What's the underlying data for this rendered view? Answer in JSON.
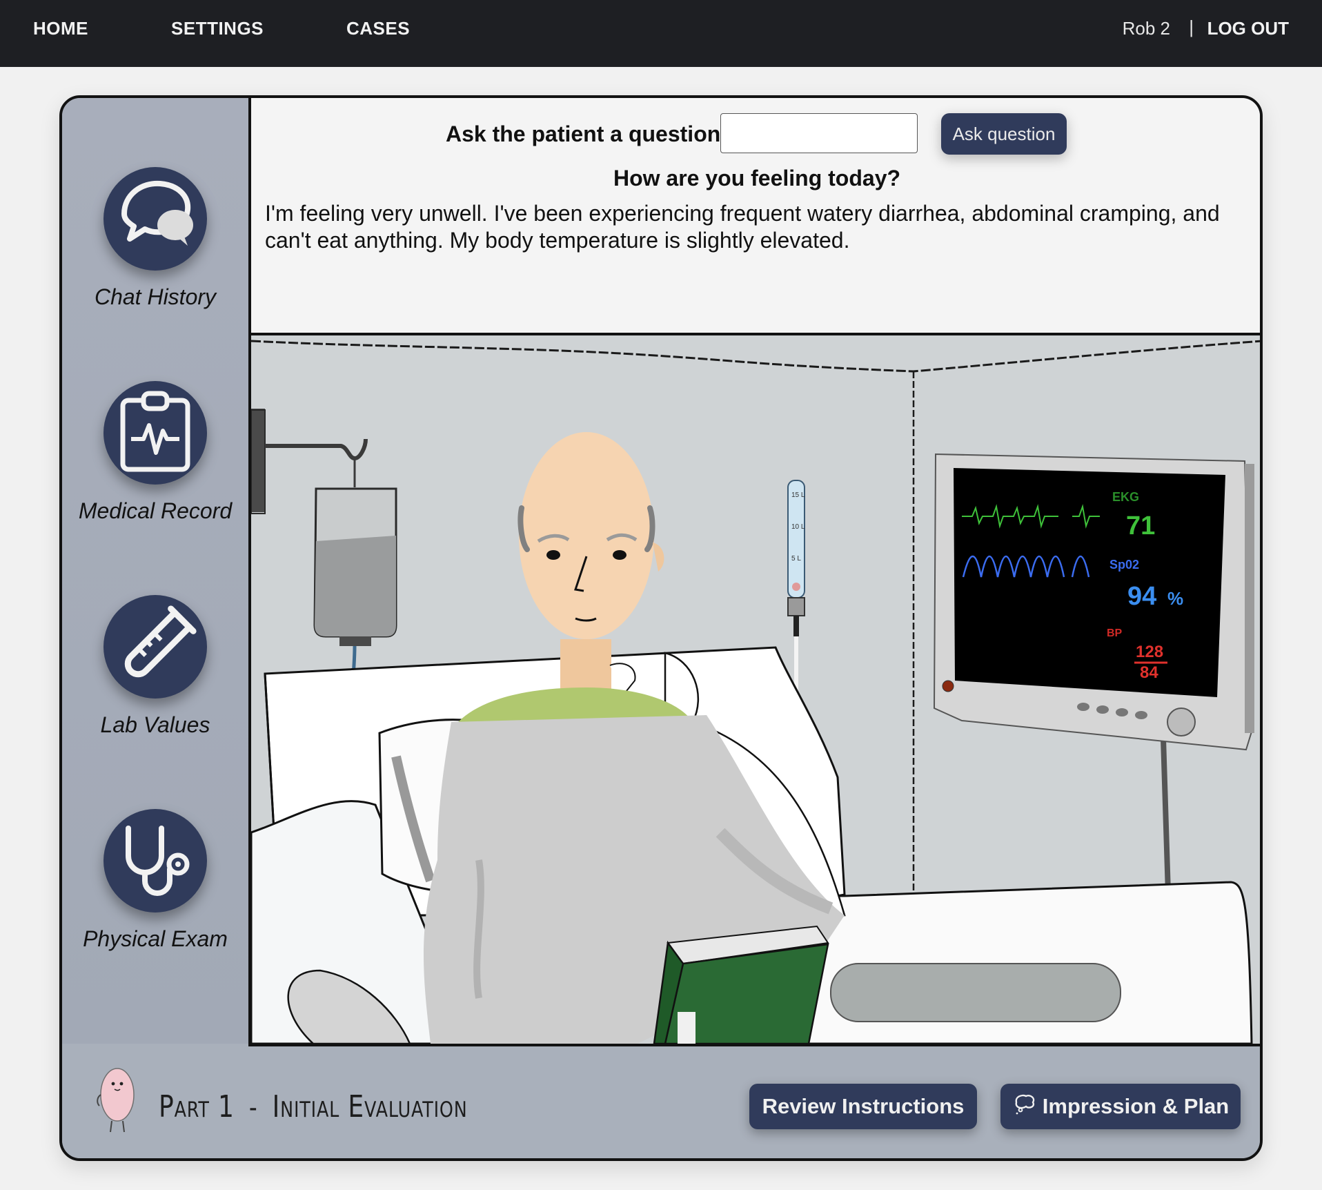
{
  "nav": {
    "home": "HOME",
    "settings": "SETTINGS",
    "cases": "CASES",
    "user": "Rob 2",
    "separator": "|",
    "logout": "LOG OUT"
  },
  "sidebar": {
    "items": [
      {
        "label": "Chat History",
        "icon": "chat-bubbles-icon"
      },
      {
        "label": "Medical Record",
        "icon": "clipboard-ekg-icon"
      },
      {
        "label": "Lab Values",
        "icon": "test-tube-icon"
      },
      {
        "label": "Physical Exam",
        "icon": "stethoscope-icon"
      }
    ]
  },
  "qa": {
    "prompt_label": "Ask the patient a question:",
    "input_value": "",
    "button_label": "Ask question",
    "question": "How are you feeling today?",
    "answer": "I'm feeling very unwell. I've been experiencing frequent watery diarrhea, abdominal cramping, and can't eat anything. My body temperature is slightly elevated."
  },
  "monitor": {
    "ekg_label": "EKG",
    "heart_rate": "71",
    "spo2_label": "Sp02",
    "spo2_value": "94",
    "spo2_unit": "%",
    "bp_label": "BP",
    "bp_systolic": "128",
    "bp_diastolic": "84"
  },
  "flowmeter": {
    "marks": [
      "15 L",
      "10 L",
      "5 L"
    ]
  },
  "footer": {
    "part_prefix": "Part 1",
    "part_dash": "-",
    "part_name": "Initial Evaluation",
    "review_button": "Review Instructions",
    "plan_button": "Impression & Plan",
    "plan_icon": "thought-bubble-icon"
  },
  "colors": {
    "nav_bg": "#1e1f23",
    "button_bg": "#303b5b",
    "frame_bg": "#a9b0bb",
    "ekg_green": "#3fc13a",
    "spo2_blue": "#3b6cf0",
    "bp_red": "#e0312c"
  }
}
